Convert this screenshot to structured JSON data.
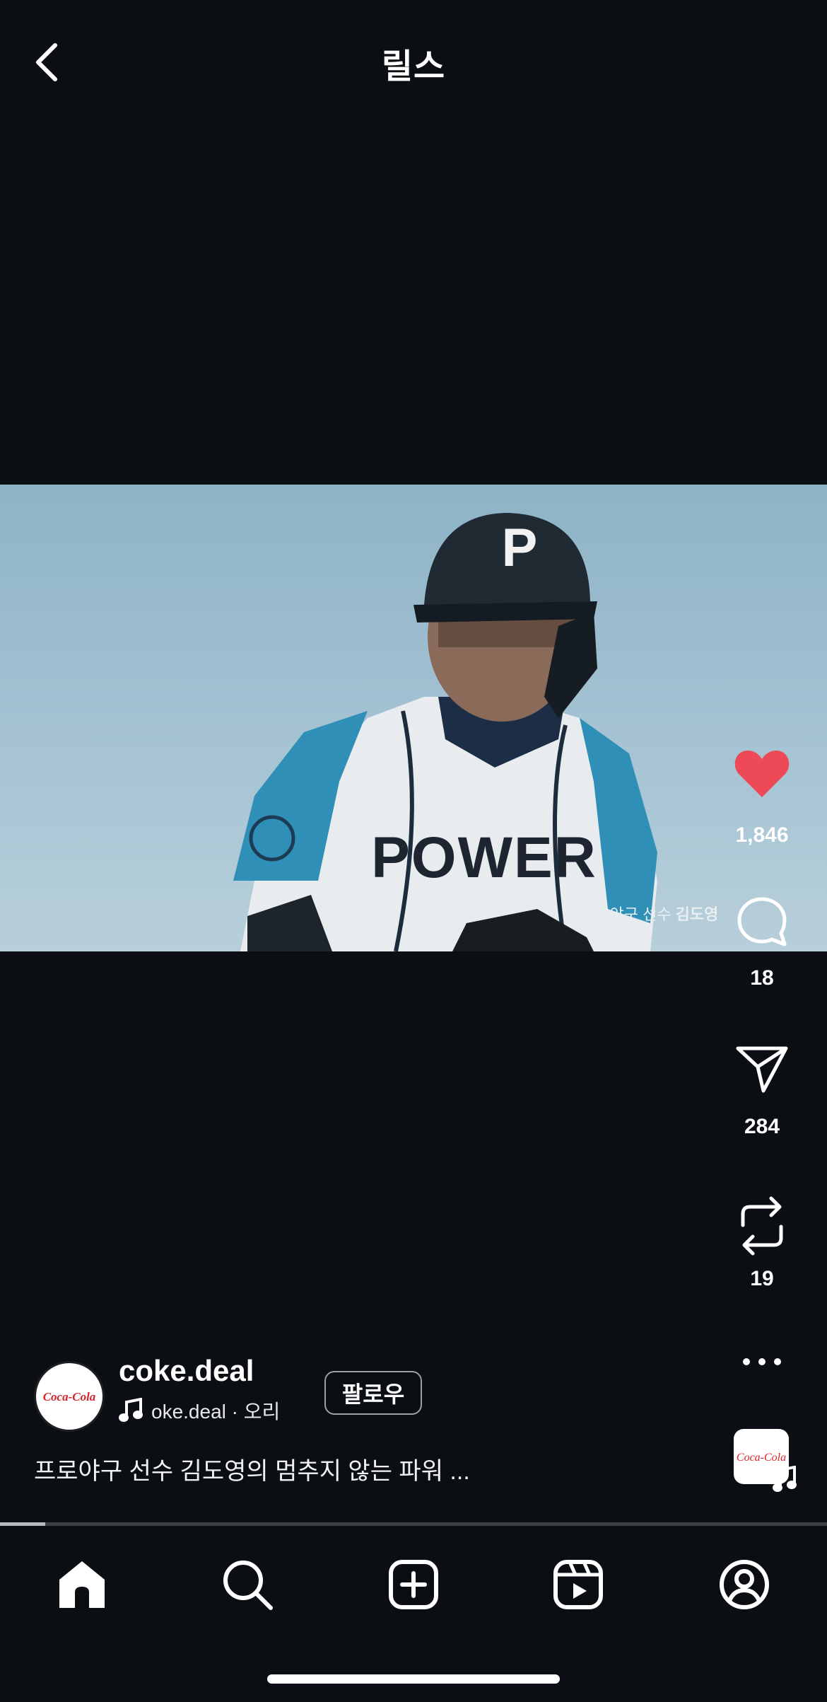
{
  "header": {
    "title": "릴스",
    "back_icon": "chevron-left-icon"
  },
  "video": {
    "overlay_caption_prefix": "프로야구 선수 ",
    "overlay_caption_name": "김도영",
    "helmet_letter": "P",
    "jersey_text": "POWER"
  },
  "actions": {
    "likes": "1,846",
    "comments": "18",
    "shares": "284",
    "remixes": "19",
    "like_color": "#ed4956"
  },
  "post": {
    "username": "coke.deal",
    "audio_text": "oke.deal · 오리",
    "follow_label": "팔로우",
    "caption": "프로야구 선수 김도영의 멈추지 않는 파워 ...",
    "brand_logo_text": "Coca-Cola"
  },
  "progress": {
    "fraction": 0.055
  },
  "tabs": [
    "home-icon",
    "search-icon",
    "create-icon",
    "reels-icon",
    "profile-icon"
  ]
}
